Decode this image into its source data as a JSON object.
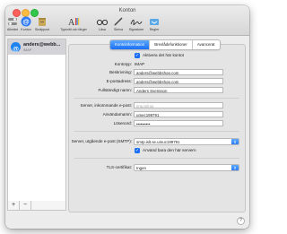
{
  "window": {
    "title": "Konton"
  },
  "toolbar": {
    "items": [
      {
        "label": "Allmänt",
        "icon": "switch-icon"
      },
      {
        "label": "Konton",
        "icon": "at-sign-icon"
      },
      {
        "label": "Skräppost",
        "icon": "junk-mail-icon"
      },
      {
        "label": "Typsnitt och färger",
        "icon": "fonts-colors-icon"
      },
      {
        "label": "Läsa",
        "icon": "glasses-icon"
      },
      {
        "label": "Skriva",
        "icon": "pen-icon"
      },
      {
        "label": "Signaturer",
        "icon": "signature-icon"
      },
      {
        "label": "Regler",
        "icon": "rules-icon"
      }
    ]
  },
  "sidebar": {
    "account": {
      "name": "anders@webb...",
      "type": "IMAP"
    },
    "add_label": "+",
    "remove_label": "−"
  },
  "tabs": [
    {
      "label": "Kontoinformation",
      "active": true
    },
    {
      "label": "Brevlådefunktioner",
      "active": false
    },
    {
      "label": "Avancerat",
      "active": false
    }
  ],
  "form": {
    "activate_label": "Aktivera det här kontot",
    "account_type_label": "Kontotyp:",
    "account_type_value": "IMAP",
    "description_label": "Beskrivning:",
    "description_value": "anders@webbshop.com",
    "email_label": "E-postadress:",
    "email_value": "anders@webbshop.com",
    "fullname_label": "Fullständigt namn:",
    "fullname_value": "Anders Svensson",
    "incoming_server_label": "Server, inkommande e-post:",
    "incoming_server_placeholder": "imp.islt.se",
    "username_label": "Användarnamn:",
    "username_value": "umec199791",
    "password_label": "Lösenord:",
    "password_value": "••••••••••",
    "smtp_label": "Server, utgående e-post (SMTP):",
    "smtp_value": "smtp.islt.se.umuc199791",
    "only_this_server_label": "Använd bara den här servern",
    "tls_label": "TLS-certifikat:",
    "tls_value": "Ingen"
  },
  "help_label": "?",
  "colors": {
    "accent": "#1a6ef5"
  }
}
